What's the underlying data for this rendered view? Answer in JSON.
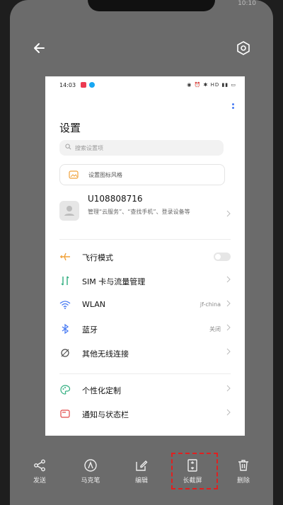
{
  "status": {
    "clock": "10:10"
  },
  "preview": {
    "status_bar": {
      "time": "14:03",
      "icons": "◉ ⏰ ✱ HD ▮▮ ▭"
    },
    "title": "设置",
    "search_placeholder": "搜索设置项",
    "theme_banner": "设置图标风格",
    "account": {
      "name": "U108808716",
      "description": "管理“云服务”、“查找手机”、登录设备等"
    },
    "rows": [
      {
        "label": "飞行模式",
        "value": "",
        "icon": "airplane-icon",
        "control": "toggle"
      },
      {
        "label": "SIM 卡与流量管理",
        "value": "",
        "icon": "sim-icon",
        "control": "chevron"
      },
      {
        "label": "WLAN",
        "value": "jf-china",
        "icon": "wifi-icon",
        "control": "chevron"
      },
      {
        "label": "蓝牙",
        "value": "关闭",
        "icon": "bluetooth-icon",
        "control": "chevron"
      },
      {
        "label": "其他无线连接",
        "value": "",
        "icon": "wireless-icon",
        "control": "chevron"
      },
      {
        "label": "个性化定制",
        "value": "",
        "icon": "palette-icon",
        "control": "chevron"
      },
      {
        "label": "通知与状态栏",
        "value": "",
        "icon": "notification-icon",
        "control": "chevron"
      }
    ]
  },
  "bottom_bar": {
    "share": "发送",
    "markup": "马克笔",
    "edit": "编辑",
    "long_screenshot": "长截屏",
    "delete": "删除"
  },
  "colors": {
    "accent_blue": "#4a7cf3",
    "airplane_orange": "#f0a23b",
    "sim_green": "#2fae7f",
    "highlight_red": "#e02020"
  }
}
